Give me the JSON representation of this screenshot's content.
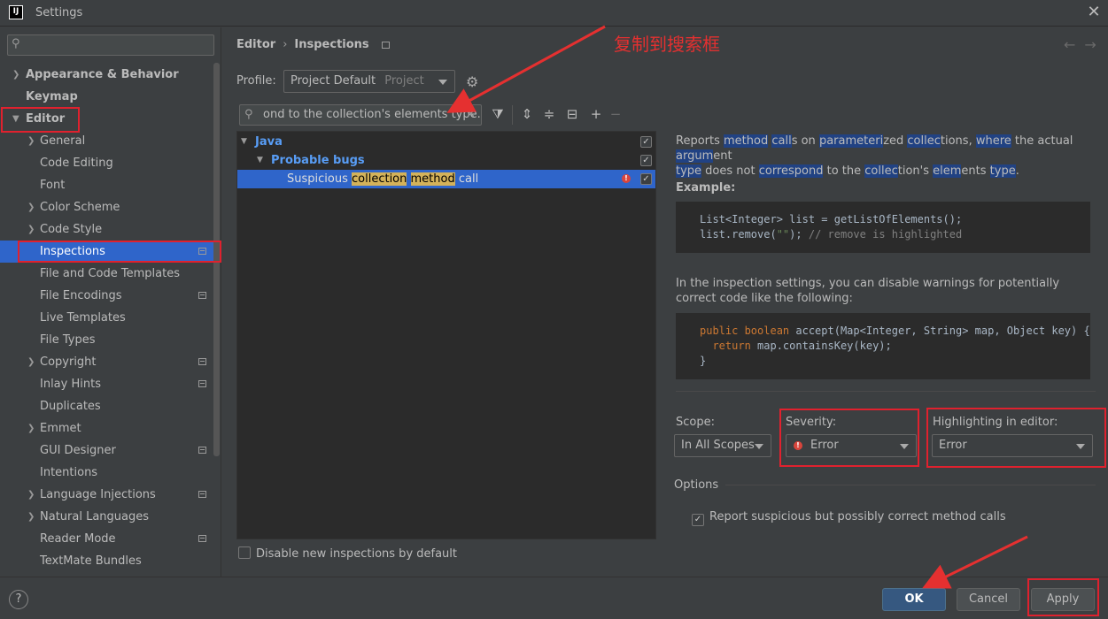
{
  "window": {
    "title": "Settings",
    "app_icon": "IJ"
  },
  "sidebar": {
    "items": [
      {
        "label": "Appearance & Behavior",
        "arrow": "right",
        "bold": true
      },
      {
        "label": "Keymap",
        "bold": true
      },
      {
        "label": "Editor",
        "arrow": "down",
        "bold": true
      },
      {
        "label": "General",
        "arrow": "right"
      },
      {
        "label": "Code Editing"
      },
      {
        "label": "Font"
      },
      {
        "label": "Color Scheme",
        "arrow": "right"
      },
      {
        "label": "Code Style",
        "arrow": "right"
      },
      {
        "label": "Inspections",
        "selected": true,
        "project_icon": true
      },
      {
        "label": "File and Code Templates"
      },
      {
        "label": "File Encodings",
        "project_icon": true
      },
      {
        "label": "Live Templates"
      },
      {
        "label": "File Types"
      },
      {
        "label": "Copyright",
        "arrow": "right",
        "project_icon": true
      },
      {
        "label": "Inlay Hints",
        "project_icon": true
      },
      {
        "label": "Duplicates"
      },
      {
        "label": "Emmet",
        "arrow": "right"
      },
      {
        "label": "GUI Designer",
        "project_icon": true
      },
      {
        "label": "Intentions"
      },
      {
        "label": "Language Injections",
        "arrow": "right",
        "project_icon": true
      },
      {
        "label": "Natural Languages",
        "arrow": "right"
      },
      {
        "label": "Reader Mode",
        "project_icon": true
      },
      {
        "label": "TextMate Bundles"
      }
    ]
  },
  "breadcrumb": {
    "parent": "Editor",
    "current": "Inspections"
  },
  "profile": {
    "label": "Profile:",
    "name": "Project Default",
    "scope": "Project"
  },
  "filter": {
    "value": "ond to the collection's elements type."
  },
  "tree": {
    "rows": [
      {
        "label": "Java",
        "level": 0
      },
      {
        "label": "Probable bugs",
        "level": 1
      },
      {
        "label_before": "Suspicious",
        "hl1": "collection",
        "hl2": "method",
        "label_after": "call",
        "level": 2
      }
    ]
  },
  "disable_new": "Disable new inspections by default",
  "description": {
    "line1": [
      [
        "Reports ",
        false
      ],
      [
        "method",
        true
      ],
      [
        " ",
        false
      ],
      [
        "call",
        true
      ],
      [
        "s on ",
        false
      ],
      [
        "parameteri",
        true
      ],
      [
        "zed ",
        false
      ],
      [
        "collec",
        true
      ],
      [
        "tions, ",
        false
      ],
      [
        "where",
        true
      ],
      [
        " the actual ",
        false
      ],
      [
        "argum",
        true
      ],
      [
        "ent",
        false
      ]
    ],
    "line2": [
      [
        "type",
        true
      ],
      [
        " does not ",
        false
      ],
      [
        "correspond",
        true
      ],
      [
        " to the ",
        false
      ],
      [
        "collec",
        true
      ],
      [
        "tion's ",
        false
      ],
      [
        "elem",
        true
      ],
      [
        "ents ",
        false
      ],
      [
        "type",
        true
      ],
      [
        ".",
        false
      ]
    ],
    "example_label": "Example:",
    "code1_line1": "List<Integer> list = getListOfElements();",
    "code1_line2a": "list.remove(",
    "code1_line2b": "\"\"",
    "code1_line2c": "); ",
    "code1_line2d": "// remove is highlighted",
    "para": "In the inspection settings, you can disable warnings for potentially correct code like the following:",
    "code2_kw1": "public boolean ",
    "code2_rest1": "accept(Map<Integer, String> map, Object key) {",
    "code2_kw2": "return ",
    "code2_rest2": "map.containsKey(key);",
    "code2_close": "}"
  },
  "scope": {
    "label": "Scope:",
    "value": "In All Scopes"
  },
  "severity": {
    "label": "Severity:",
    "value": "Error"
  },
  "highlighting": {
    "label": "Highlighting in editor:",
    "value": "Error"
  },
  "options": {
    "label": "Options",
    "check": "Report suspicious but possibly correct method calls"
  },
  "buttons": {
    "ok": "OK",
    "cancel": "Cancel",
    "apply": "Apply",
    "help": "?"
  },
  "annotation": {
    "text": "复制到搜索框"
  },
  "colors": {
    "accent": "#2f65ca",
    "highlight": "#214283",
    "annotation": "#e0212e",
    "match": "#d4b25a",
    "error": "#d9453c"
  }
}
